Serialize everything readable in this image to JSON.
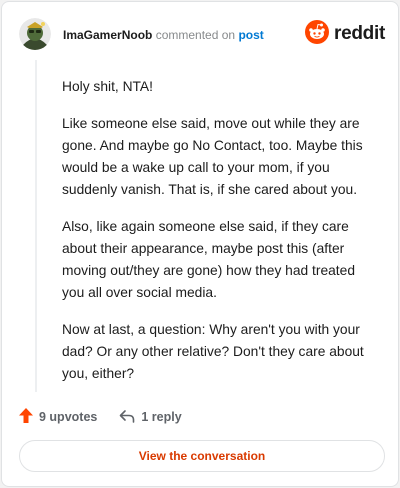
{
  "header": {
    "username": "ImaGamerNoob",
    "commented_on": "commented on",
    "post_link": "post",
    "brand_word": "reddit"
  },
  "comment": {
    "paragraphs": [
      "Holy shit, NTA!",
      "Like someone else said, move out while they are gone. And maybe go No Contact, too. Maybe this would be a wake up call to your mom, if you suddenly vanish. That is, if she cared about you.",
      "Also, like again someone else said, if they care about their appearance, maybe post this (after moving out/they are gone) how they had treated you all over social media.",
      "Now at last, a question: Why aren't you with your dad? Or any other relative? Don't they care about you, either?"
    ]
  },
  "actions": {
    "upvotes": "9 upvotes",
    "replies": "1 reply"
  },
  "cta": {
    "label": "View the conversation"
  },
  "colors": {
    "brand": "#ff4500",
    "link": "#0079d3",
    "cta": "#d93a00"
  },
  "icons": {
    "avatar": "avatar-icon",
    "brand": "reddit-logo-icon",
    "upvote": "upvote-arrow-icon",
    "reply": "reply-arrow-icon"
  }
}
